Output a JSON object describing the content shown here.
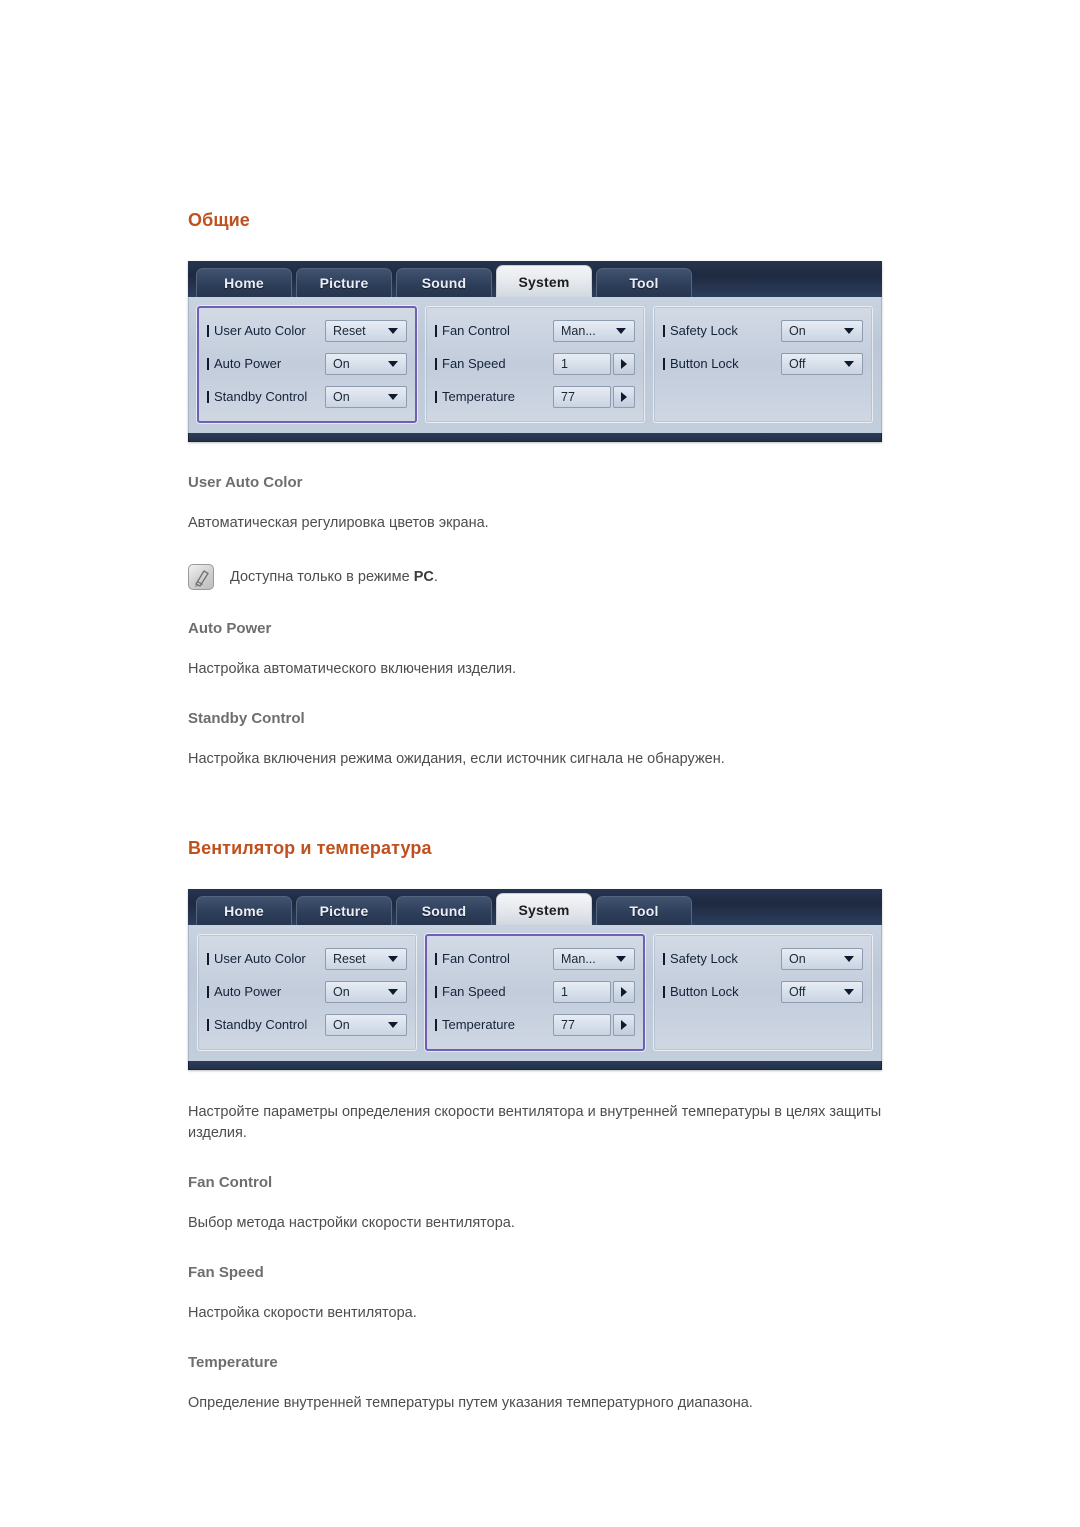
{
  "sections": [
    {
      "heading": "Общие",
      "osd": {
        "tabs": [
          {
            "label": "Home",
            "active": false
          },
          {
            "label": "Picture",
            "active": false
          },
          {
            "label": "Sound",
            "active": false
          },
          {
            "label": "System",
            "active": true
          },
          {
            "label": "Tool",
            "active": false
          }
        ],
        "selected_column": 0,
        "columns": [
          {
            "rows": [
              {
                "label": "User Auto Color",
                "value": "Reset",
                "control": "dropdown"
              },
              {
                "label": "Auto Power",
                "value": "On",
                "control": "dropdown"
              },
              {
                "label": "Standby Control",
                "value": "On",
                "control": "dropdown"
              }
            ]
          },
          {
            "rows": [
              {
                "label": "Fan Control",
                "value": "Man...",
                "control": "dropdown"
              },
              {
                "label": "Fan Speed",
                "value": "1",
                "control": "stepper"
              },
              {
                "label": "Temperature",
                "value": "77",
                "control": "stepper"
              }
            ]
          },
          {
            "rows": [
              {
                "label": "Safety Lock",
                "value": "On",
                "control": "dropdown"
              },
              {
                "label": "Button Lock",
                "value": "Off",
                "control": "dropdown"
              }
            ]
          }
        ]
      },
      "blocks": [
        {
          "type": "subheading",
          "text": "User Auto Color"
        },
        {
          "type": "paragraph",
          "text": "Автоматическая регулировка цветов экрана."
        },
        {
          "type": "note",
          "text_before": "Доступна только в режиме ",
          "text_bold": "PC",
          "text_after": ".",
          "icon": "note-pencil-icon"
        },
        {
          "type": "subheading",
          "text": "Auto Power"
        },
        {
          "type": "paragraph",
          "text": "Настройка автоматического включения изделия."
        },
        {
          "type": "subheading",
          "text": "Standby Control"
        },
        {
          "type": "paragraph",
          "text": "Настройка включения режима ожидания, если источник сигнала не обнаружен."
        }
      ]
    },
    {
      "heading": "Вентилятор и температура",
      "osd": {
        "tabs": [
          {
            "label": "Home",
            "active": false
          },
          {
            "label": "Picture",
            "active": false
          },
          {
            "label": "Sound",
            "active": false
          },
          {
            "label": "System",
            "active": true
          },
          {
            "label": "Tool",
            "active": false
          }
        ],
        "selected_column": 1,
        "columns": [
          {
            "rows": [
              {
                "label": "User Auto Color",
                "value": "Reset",
                "control": "dropdown"
              },
              {
                "label": "Auto Power",
                "value": "On",
                "control": "dropdown"
              },
              {
                "label": "Standby Control",
                "value": "On",
                "control": "dropdown"
              }
            ]
          },
          {
            "rows": [
              {
                "label": "Fan Control",
                "value": "Man...",
                "control": "dropdown"
              },
              {
                "label": "Fan Speed",
                "value": "1",
                "control": "stepper"
              },
              {
                "label": "Temperature",
                "value": "77",
                "control": "stepper"
              }
            ]
          },
          {
            "rows": [
              {
                "label": "Safety Lock",
                "value": "On",
                "control": "dropdown"
              },
              {
                "label": "Button Lock",
                "value": "Off",
                "control": "dropdown"
              }
            ]
          }
        ]
      },
      "blocks": [
        {
          "type": "paragraph",
          "text": "Настройте параметры определения скорости вентилятора и внутренней температуры в целях защиты изделия."
        },
        {
          "type": "subheading",
          "text": "Fan Control"
        },
        {
          "type": "paragraph",
          "text": "Выбор метода настройки скорости вентилятора."
        },
        {
          "type": "subheading",
          "text": "Fan Speed"
        },
        {
          "type": "paragraph",
          "text": "Настройка скорости вентилятора."
        },
        {
          "type": "subheading",
          "text": "Temperature"
        },
        {
          "type": "paragraph",
          "text": "Определение внутренней температуры путем указания температурного диапазона."
        }
      ]
    }
  ],
  "colors": {
    "heading_orange": "#c0501e",
    "subheading_grey": "#6e6e6e",
    "body_grey": "#4d4d4d",
    "osd_tabbar_dark": "#26344f",
    "osd_selection_purple": "#6f5fb5",
    "osd_panel_blue": "#c9d3e0"
  }
}
